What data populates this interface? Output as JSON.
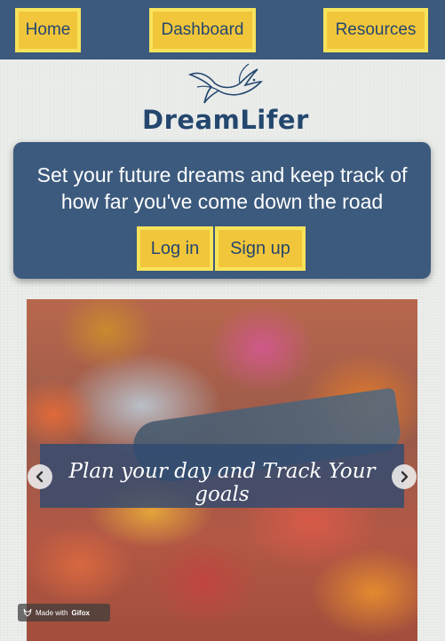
{
  "nav": {
    "items": [
      {
        "label": "Home"
      },
      {
        "label": "Dashboard"
      },
      {
        "label": "Resources"
      }
    ]
  },
  "brand": {
    "name": "DreamLifer",
    "icon": "dove-icon"
  },
  "hero": {
    "text": "Set your future dreams and keep track of how far you've come down the road",
    "login_label": "Log in",
    "signup_label": "Sign up"
  },
  "carousel": {
    "caption": "Plan your day and Track Your goals",
    "prev_icon": "chevron-left-icon",
    "next_icon": "chevron-right-icon"
  },
  "watermark": {
    "prefix": "Made with",
    "name": "Gifox"
  },
  "colors": {
    "navy": "#3c5a7d",
    "gold": "#f2c63b",
    "gold_border": "#f7e35b",
    "text_dark": "#24476e",
    "background": "#eceeec"
  }
}
